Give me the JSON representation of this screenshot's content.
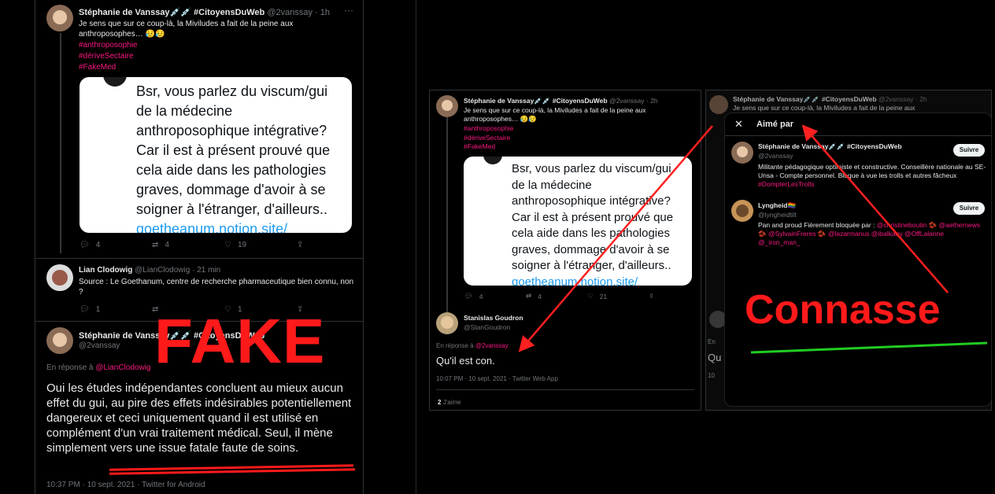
{
  "left": {
    "tweet1": {
      "name": "Stéphanie de Vanssay💉💉 #CitoyensDuWeb",
      "handle": "@2vanssay",
      "dot": "·",
      "time": "1h",
      "text": "Je sens que sur ce coup-là, la Miviludes a fait de la peine aux anthroposophes… 😥😥",
      "tags": [
        "#anthroposophie",
        "#dériveSectaire",
        "#FakeMed"
      ],
      "quote_lines": [
        "Bsr, vous parlez du viscum/gui",
        "de la médecine",
        "anthroposophique intégrative?",
        "Car il est à présent prouvé que",
        "cela aide dans les pathologies",
        "graves, dommage d'avoir à se",
        "soigner à l'étranger, d'ailleurs..",
        "goetheanum.notion.site/"
      ],
      "replies": "4",
      "retweets": "4",
      "likes": "19"
    },
    "tweet2": {
      "name": "Lian Clodowig",
      "handle": "@LianClodowig",
      "dot": "·",
      "time": "21 min",
      "text": "Source : Le Goethanum, centre de recherche pharmaceutique bien connu, non ?",
      "replies": "1",
      "likes": "1"
    },
    "tweet3": {
      "name": "Stéphanie de Vanssay💉💉 #CitoyensDuWeb",
      "handle": "@2vanssay",
      "reply_prefix": "En réponse à",
      "reply_to": "@LianClodowig",
      "text": "Oui les études indépendantes concluent au mieux aucun effet du gui, au pire des effets indésirables potentiellement dangereux et ceci uniquement quand il est utilisé en complément d'un vrai traitement médical. Seul, il mène simplement vers une issue fatale faute de soins.",
      "meta": "10:37 PM · 10 sept. 2021 · Twitter for Android"
    },
    "overlay": "FAKE"
  },
  "right": {
    "tweet1": {
      "name": "Stéphanie de Vanssay💉💉 #CitoyensDuWeb",
      "handle": "@2vanssay",
      "dot": "·",
      "time": "2h",
      "text": "Je sens que sur ce coup-là, la Miviludes a fait de la peine aux anthroposophes… 😥😥",
      "tags": [
        "#anthroposophie",
        "#dériveSectaire",
        "#FakeMed"
      ],
      "replies": "4",
      "retweets": "4",
      "likes": "21"
    },
    "tweet2": {
      "name": "Stanislas Goudron",
      "handle": "@StanGoudron",
      "reply_prefix": "En réponse à",
      "reply_to": "@2vanssay",
      "text": "Qu'il est con.",
      "meta": "10:07 PM · 10 sept. 2021 · Twitter Web App",
      "likes_count": "2",
      "likes_label": "J'aime"
    },
    "behind": {
      "name": "Stéphanie de Vanssay💉💉 #CitoyensDuWeb",
      "handle": "@2vanssay",
      "dot": "·",
      "time": "2h",
      "text": "Je sens que sur ce coup-là, la Miviludes a fait de la peine aux",
      "reply_fragment": "En",
      "qu_fragment": "Qu",
      "ten_fragment": "10"
    },
    "modal": {
      "close": "✕",
      "title": "Aimé par",
      "users": [
        {
          "name": "Stéphanie de Vanssay💉💉 #CitoyensDuWeb",
          "handle": "@2vanssay",
          "bio": "Militante pédagogique optimiste et constructive. Conseillère nationale au SE-Unsa - Compte personnel. Bloque à vue les trolls et autres fâcheux",
          "bio_tag": "#DompterLesTrolls",
          "button": "Suivre"
        },
        {
          "name": "Lyngheid🏳️‍🌈",
          "handle": "@lyngheidtilt",
          "bio": "Pan and proud Fièrement bloquée par :",
          "bio_tags": "@christineboutin 🫘 @aethernews 🫘 @SylvainFreres 🫘 @lazarmanus @ibalkany @OffLalanne @_iron_man_",
          "button": "Suivre"
        }
      ]
    },
    "overlay": "Connasse"
  },
  "colors": {
    "accent_pink": "#f91880",
    "link_blue": "#1d9bf0",
    "overlay_red": "#ff1a1a",
    "underline_green": "#22cc22"
  }
}
